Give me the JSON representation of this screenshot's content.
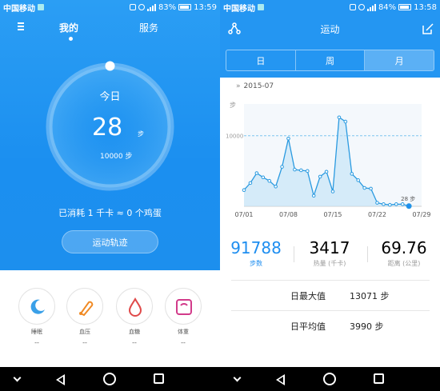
{
  "left": {
    "status": {
      "carrier": "中国移动",
      "battery": "83%",
      "time": "13:59"
    },
    "tabs": {
      "mine": "我的",
      "service": "服务"
    },
    "ring": {
      "today": "今日",
      "steps": "28",
      "unit": "步",
      "goal": "10000 步",
      "progress": 0.0028
    },
    "calorie_text": "已消耗 1 千卡 ≈ 0 个鸡蛋",
    "track_button": "运动轨迹",
    "tiles": [
      {
        "label": "睡眠",
        "value": "--",
        "icon": "moon-icon",
        "color": "#3aa0e8"
      },
      {
        "label": "血压",
        "value": "--",
        "icon": "blood-pressure-icon",
        "color": "#f08a24"
      },
      {
        "label": "血糖",
        "value": "--",
        "icon": "blood-drop-icon",
        "color": "#e04a4a"
      },
      {
        "label": "体重",
        "value": "--",
        "icon": "scale-icon",
        "color": "#d23b8a"
      }
    ]
  },
  "right": {
    "status": {
      "carrier": "中国移动",
      "battery": "84%",
      "time": "13:58"
    },
    "title": "运动",
    "segments": [
      "日",
      "周",
      "月"
    ],
    "active_segment": "月",
    "month_label": "2015-07",
    "stats": [
      {
        "value": "91788",
        "caption": "步数",
        "color": "#1e8ef0"
      },
      {
        "value": "3417",
        "caption": "热量 (千卡)",
        "color": "#222222"
      },
      {
        "value": "69.76",
        "caption": "距离 (公里)",
        "color": "#222222"
      }
    ],
    "rows": [
      {
        "label": "日最大值",
        "value": "13071 步"
      },
      {
        "label": "日平均值",
        "value": "3990 步"
      }
    ]
  },
  "chart_data": {
    "type": "line",
    "title": "",
    "xlabel": "",
    "ylabel": "步",
    "x_ticks": [
      "07/01",
      "07/08",
      "07/15",
      "07/22",
      "07/29"
    ],
    "reference_line": {
      "value": 10000,
      "label": "10000"
    },
    "last_point_label": "28 步",
    "ylim": [
      0,
      14500
    ],
    "x": [
      1,
      2,
      3,
      4,
      5,
      6,
      7,
      8,
      9,
      10,
      11,
      12,
      13,
      14,
      15,
      16,
      17,
      18,
      19,
      20,
      21,
      22,
      23,
      24,
      25,
      26,
      27
    ],
    "values": [
      2300,
      3300,
      4700,
      4100,
      3600,
      2800,
      5600,
      9600,
      5200,
      5100,
      5000,
      1500,
      4200,
      4900,
      2100,
      12600,
      12000,
      4600,
      3700,
      2600,
      2500,
      500,
      300,
      200,
      300,
      300,
      28
    ],
    "series": [
      {
        "name": "",
        "values": []
      }
    ]
  }
}
